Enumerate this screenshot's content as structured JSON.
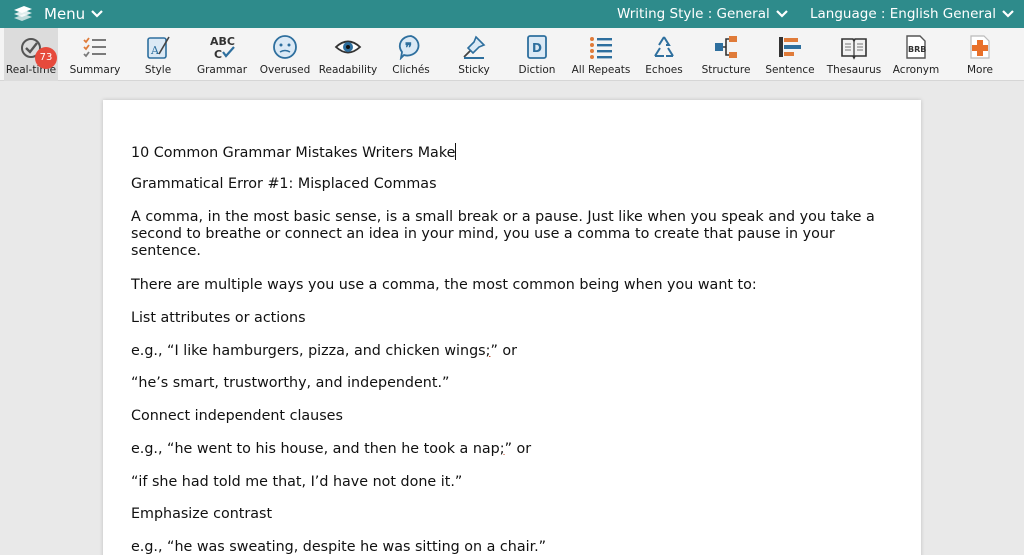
{
  "topbar": {
    "menu_label": "Menu",
    "writing_style": "Writing Style : General",
    "language": "Language : English General"
  },
  "toolbar": {
    "badge_count": "73",
    "tools": [
      {
        "label": "Real-time"
      },
      {
        "label": "Summary"
      },
      {
        "label": "Style"
      },
      {
        "label": "Grammar"
      },
      {
        "label": "Overused"
      },
      {
        "label": "Readability"
      },
      {
        "label": "Clichés"
      },
      {
        "label": "Sticky"
      },
      {
        "label": "Diction"
      },
      {
        "label": "All Repeats"
      },
      {
        "label": "Echoes"
      },
      {
        "label": "Structure"
      },
      {
        "label": "Sentence"
      },
      {
        "label": "Thesaurus"
      },
      {
        "label": "Acronym"
      },
      {
        "label": "More"
      }
    ]
  },
  "document": {
    "p0": "10 Common Grammar Mistakes Writers Make",
    "p1": "Grammatical Error #1: Misplaced Commas",
    "p2": "A comma, in the most basic sense, is a small break or a pause. Just like when you speak and you take a second to breathe or connect an idea in your mind, you use a comma to create that pause in your sentence.",
    "p3": "There are multiple ways you use a comma, the most common being when you want to:",
    "p4": "List attributes or actions",
    "p5a": "e.g., “I like hamburgers, pizza, and chicken wings",
    "p5b": ";",
    "p5c": "” or",
    "p6": "“he’s smart, trustworthy, and independent.”",
    "p7": "Connect independent clauses",
    "p8a": "e.g., “he went to his house, and then he took a nap",
    "p8b": ";",
    "p8c": "” or",
    "p9": "“if she had told me that, I’d have not done it.”",
    "p10": "Emphasize contrast",
    "p11": "e.g., “he was sweating, despite he was sitting on a chair.”"
  }
}
